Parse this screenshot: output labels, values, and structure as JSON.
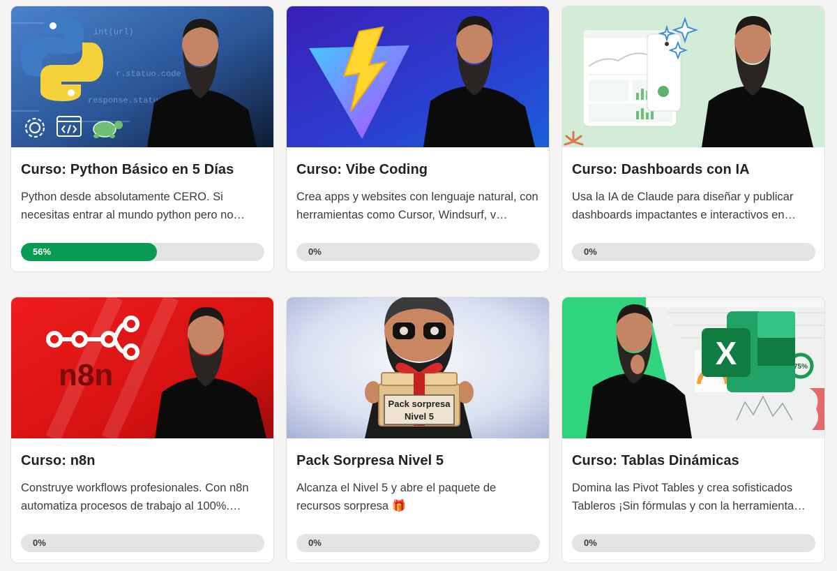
{
  "courses": [
    {
      "title": "Curso: Python Básico en 5 Días",
      "description": "Python desde absolutamente CERO. Si necesitas entrar al mundo python pero no…",
      "progress_label": "56%",
      "progress": 0.56,
      "thumbnail": {
        "bg": [
          "#3f73b8",
          "#12213a"
        ],
        "icons": [
          "python-logo-icon",
          "gear-icon",
          "code-window-icon",
          "turtle-icon"
        ],
        "code_lines": [
          "int(url)",
          "r.statuo.code",
          "response.statue.code"
        ]
      }
    },
    {
      "title": "Curso: Vibe Coding",
      "description": "Crea apps y websites con lenguaje natural, con herramientas como Cursor, Windsurf, v…",
      "progress_label": "0%",
      "progress": 0,
      "thumbnail": {
        "bg": [
          "#2b1ea8",
          "#1f5bd6"
        ],
        "icons": [
          "vite-logo-icon"
        ]
      }
    },
    {
      "title": "Curso: Dashboards con IA",
      "description": "Usa la IA de Claude para diseñar y publicar dashboards impactantes e interactivos en…",
      "progress_label": "0%",
      "progress": 0,
      "thumbnail": {
        "bg": [
          "#d5eedb",
          "#cfe9d3"
        ],
        "icons": [
          "dashboard-mockup-icon",
          "sparkle-icon",
          "claude-asterisk-icon"
        ]
      }
    },
    {
      "title": "Curso: n8n",
      "description": "Construye workflows profesionales. Con n8n automatiza procesos de trabajo al 100%.…",
      "progress_label": "0%",
      "progress": 0,
      "thumbnail": {
        "bg": [
          "#e41414",
          "#a10c0c"
        ],
        "logo_text": "n8n",
        "icons": [
          "n8n-workflow-icon"
        ]
      }
    },
    {
      "title": "Pack Sorpresa Nivel 5",
      "description": "Alcanza el Nivel 5 y abre el paquete de recursos sorpresa 🎁",
      "progress_label": "0%",
      "progress": 0,
      "thumbnail": {
        "bg": [
          "#f2f5fb",
          "#aab7da"
        ],
        "box_text_1": "Pack sorpresa",
        "box_text_2": "Nivel 5",
        "icons": [
          "avatar-3d-icon",
          "gift-box-icon"
        ]
      }
    },
    {
      "title": "Curso: Tablas Dinámicas",
      "description": "Domina las Pivot Tables y crea sofisticados Tableros ¡Sin fórmulas y con la herramienta…",
      "progress_label": "0%",
      "progress": 0,
      "thumbnail": {
        "bg": [
          "#2fd47c",
          "#f3f5f3"
        ],
        "icons": [
          "excel-logo-icon",
          "spreadsheet-icon"
        ],
        "excel_letter": "X",
        "gauge_label": "75%"
      }
    }
  ],
  "colors": {
    "progress_fill": "#089b54",
    "progress_track": "#e4e4e4",
    "title": "#222222",
    "description": "#3c3c3c"
  }
}
